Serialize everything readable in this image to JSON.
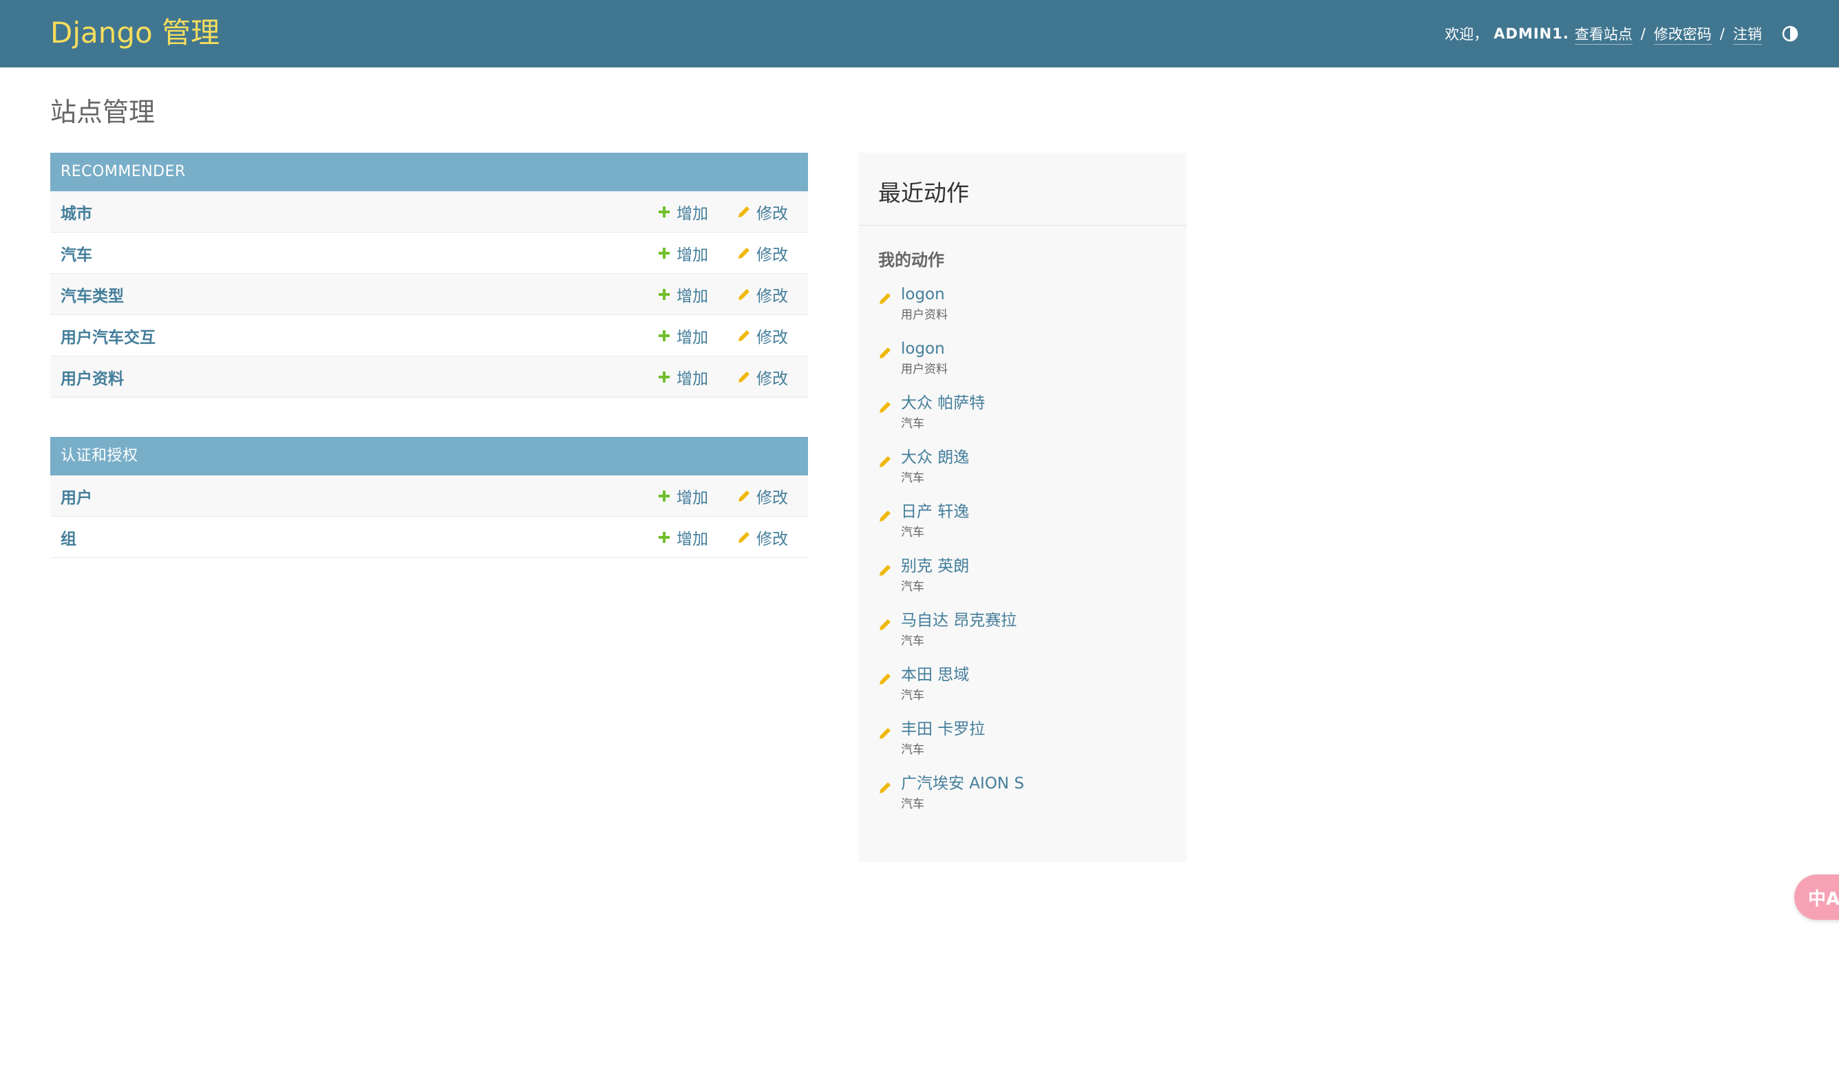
{
  "header": {
    "brand": "Django 管理",
    "welcome": "欢迎，",
    "username": "ADMIN1",
    "username_suffix": ".",
    "view_site": "查看站点",
    "change_password": "修改密码",
    "logout": "注销",
    "separator": "/"
  },
  "page_title": "站点管理",
  "modules": [
    {
      "caption": "RECOMMENDER",
      "rows": [
        {
          "name": "城市",
          "add": "增加",
          "change": "修改"
        },
        {
          "name": "汽车",
          "add": "增加",
          "change": "修改"
        },
        {
          "name": "汽车类型",
          "add": "增加",
          "change": "修改"
        },
        {
          "name": "用户汽车交互",
          "add": "增加",
          "change": "修改"
        },
        {
          "name": "用户资料",
          "add": "增加",
          "change": "修改"
        }
      ]
    },
    {
      "caption": "认证和授权",
      "rows": [
        {
          "name": "用户",
          "add": "增加",
          "change": "修改"
        },
        {
          "name": "组",
          "add": "增加",
          "change": "修改"
        }
      ]
    }
  ],
  "recent_actions": {
    "title": "最近动作",
    "subtitle": "我的动作",
    "items": [
      {
        "label": "logon",
        "type": "用户资料"
      },
      {
        "label": "logon",
        "type": "用户资料"
      },
      {
        "label": "大众 帕萨特",
        "type": "汽车"
      },
      {
        "label": "大众 朗逸",
        "type": "汽车"
      },
      {
        "label": "日产 轩逸",
        "type": "汽车"
      },
      {
        "label": "别克 英朗",
        "type": "汽车"
      },
      {
        "label": "马自达 昂克赛拉",
        "type": "汽车"
      },
      {
        "label": "本田 思域",
        "type": "汽车"
      },
      {
        "label": "丰田 卡罗拉",
        "type": "汽车"
      },
      {
        "label": "广汽埃安 AION S",
        "type": "汽车"
      }
    ]
  },
  "translate_button": {
    "label": "中A"
  },
  "colors": {
    "header_bg": "#417690",
    "brand": "#f5dd5d",
    "caption_bg": "#79aec8",
    "link": "#447e9b",
    "add_icon": "#70bf2b",
    "change_icon": "#efb80b"
  }
}
